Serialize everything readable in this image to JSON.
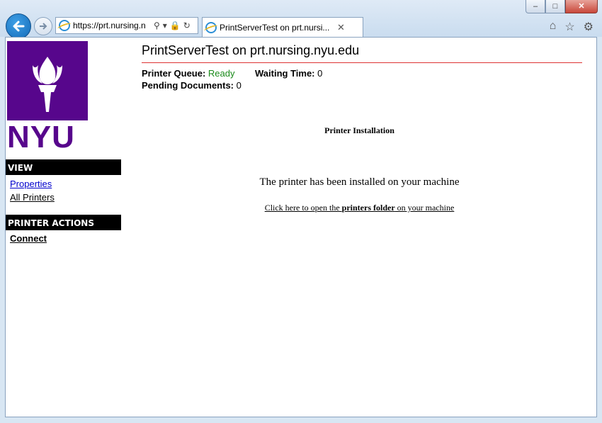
{
  "browser": {
    "address_url": "https://prt.nursing.n",
    "tab_title": "PrintServerTest on prt.nursi...",
    "window_buttons": [
      "minimize",
      "maximize",
      "close"
    ]
  },
  "page": {
    "title": "PrintServerTest on prt.nursing.nyu.edu",
    "logo_text": "NYU",
    "sidebar": {
      "view_heading": "VIEW",
      "view_links": [
        "Properties",
        "All Printers"
      ],
      "actions_heading": "PRINTER ACTIONS",
      "action_links": [
        "Connect"
      ]
    },
    "status": {
      "queue_label": "Printer Queue:",
      "queue_value": "Ready",
      "waiting_label": "Waiting Time:",
      "waiting_value": "0",
      "pending_label": "Pending Documents:",
      "pending_value": "0"
    },
    "installation": {
      "heading": "Printer Installation",
      "message": "The printer has been installed on your machine",
      "link_prefix": "Click here to open the ",
      "link_bold": "printers folder",
      "link_suffix": " on your machine"
    }
  },
  "colors": {
    "nyu_purple": "#57068c",
    "ready_green": "#1a8a1a",
    "rule_red": "#dd3333"
  }
}
